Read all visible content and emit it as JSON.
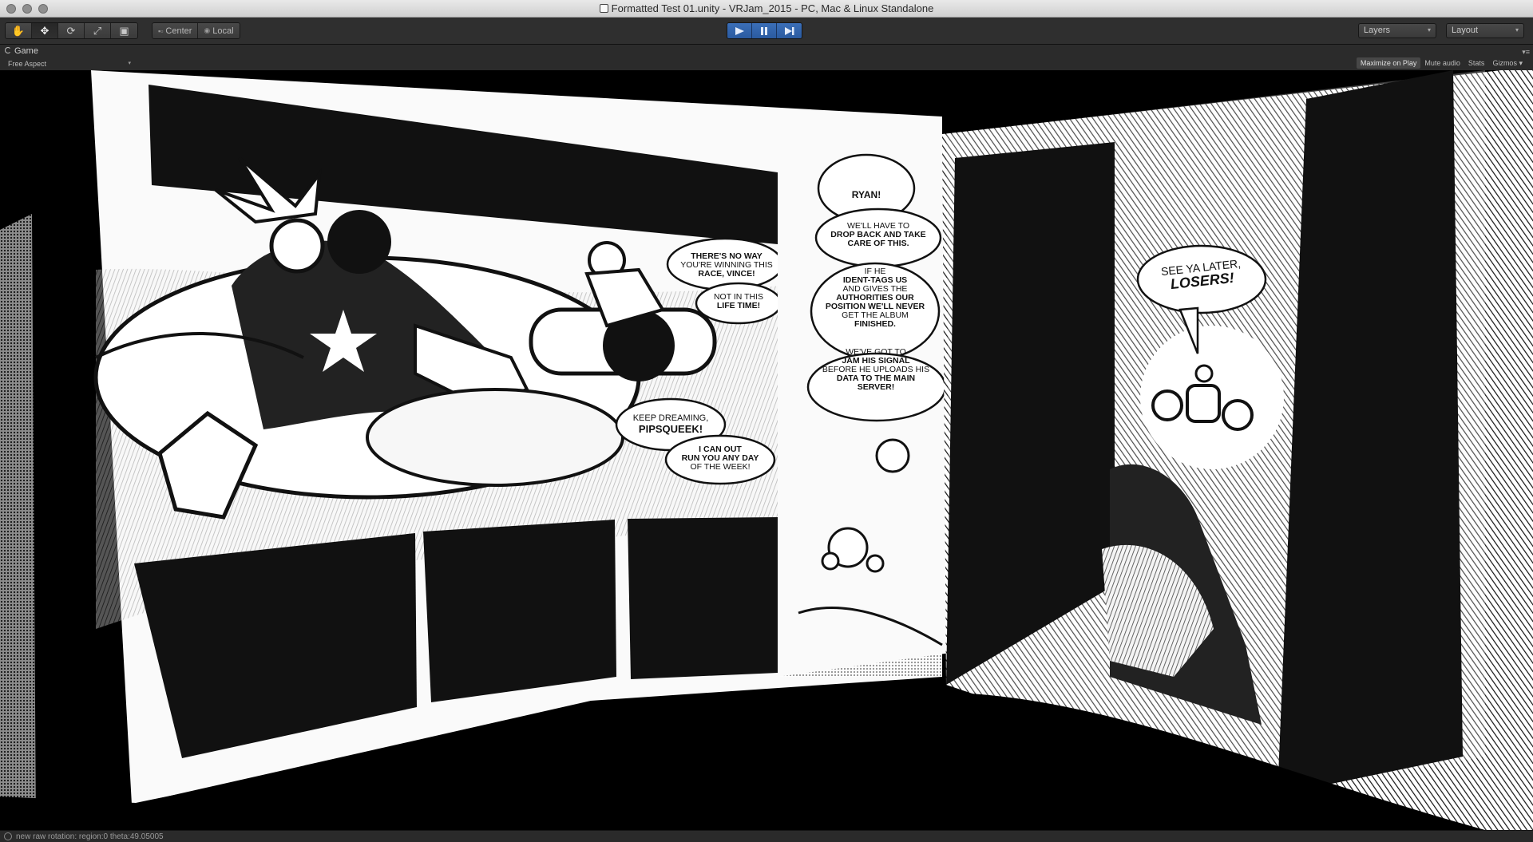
{
  "window": {
    "title": "Formatted Test 01.unity - VRJam_2015 - PC, Mac & Linux Standalone"
  },
  "toolbar": {
    "transform_tools": [
      {
        "name": "hand-tool-icon",
        "glyph": "✋"
      },
      {
        "name": "move-tool-icon",
        "glyph": "✥"
      },
      {
        "name": "rotate-tool-icon",
        "glyph": "⟳"
      },
      {
        "name": "scale-tool-icon",
        "glyph": "⤢"
      },
      {
        "name": "rect-tool-icon",
        "glyph": "▣"
      }
    ],
    "pivot_label": "Center",
    "space_label": "Local",
    "layers_label": "Layers",
    "layout_label": "Layout"
  },
  "game_view": {
    "tab_label": "Game",
    "aspect_label": "Free Aspect",
    "options": [
      "Maximize on Play",
      "Mute audio",
      "Stats",
      "Gizmos"
    ]
  },
  "comic": {
    "bubble_race": [
      "THERE'S NO WAY",
      "YOU'RE WINNING THIS",
      "RACE, VINCE!"
    ],
    "bubble_lifetime": [
      "NOT IN THIS",
      "LIFE TIME!"
    ],
    "bubble_dreaming": [
      "KEEP DREAMING,",
      "PIPSQUEEK!"
    ],
    "bubble_outrun": [
      "I CAN OUT",
      "RUN YOU ANY DAY",
      "OF THE WEEK!"
    ],
    "bubble_ryan": "RYAN!",
    "bubble_drop": [
      "WE'LL HAVE TO",
      "DROP BACK AND TAKE",
      "CARE OF THIS."
    ],
    "bubble_authorities": [
      "IF HE",
      "IDENT-TAGS US",
      "AND GIVES THE",
      "AUTHORITIES OUR",
      "POSITION WE'LL NEVER",
      "GET THE ALBUM",
      "FINISHED."
    ],
    "bubble_jam": [
      "WE'VE GOT TO",
      "JAM HIS SIGNAL",
      "BEFORE HE UPLOADS HIS",
      "DATA TO THE MAIN",
      "SERVER!"
    ],
    "bubble_losers": [
      "SEE YA LATER,",
      "LOSERS!"
    ]
  },
  "status": {
    "message": "new raw rotation: region:0 theta:49.05005"
  }
}
